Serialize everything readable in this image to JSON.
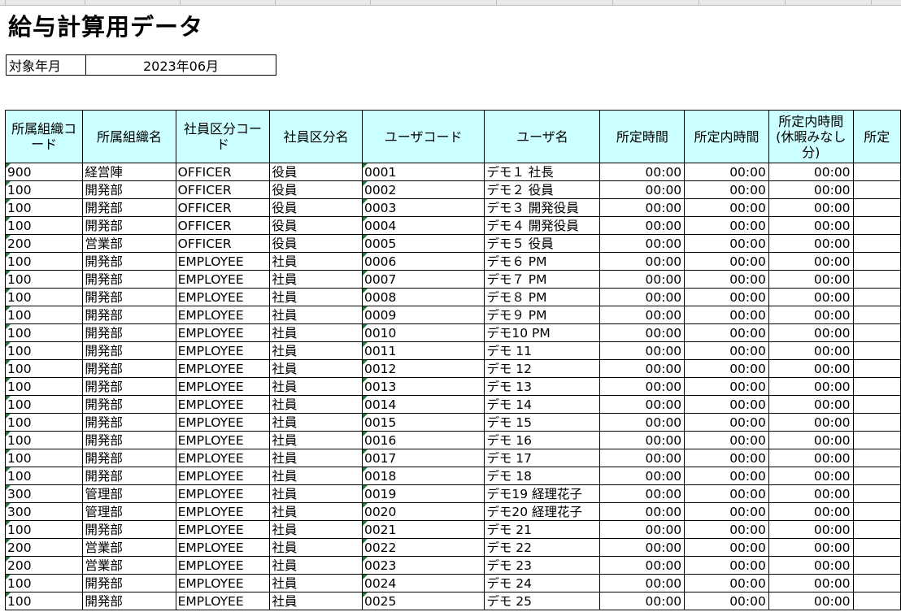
{
  "sheet": {
    "title": "給与計算用データ",
    "period_label": "対象年月",
    "period_value": "2023年06月"
  },
  "columns": [
    "所属組織コード",
    "所属組織名",
    "社員区分コード",
    "社員区分名",
    "ユーザコード",
    "ユーザ名",
    "所定時間",
    "所定内時間",
    "所定内時間(休暇みなし分)",
    "所定"
  ],
  "header_bg": "#ccffff",
  "rows": [
    [
      "900",
      "経営陣",
      "OFFICER",
      "役員",
      "0001",
      "デモ１ 社長",
      "00:00",
      "00:00",
      "00:00"
    ],
    [
      "100",
      "開発部",
      "OFFICER",
      "役員",
      "0002",
      "デモ２ 役員",
      "00:00",
      "00:00",
      "00:00"
    ],
    [
      "100",
      "開発部",
      "OFFICER",
      "役員",
      "0003",
      "デモ３ 開発役員",
      "00:00",
      "00:00",
      "00:00"
    ],
    [
      "100",
      "開発部",
      "OFFICER",
      "役員",
      "0004",
      "デモ４ 開発役員",
      "00:00",
      "00:00",
      "00:00"
    ],
    [
      "200",
      "営業部",
      "OFFICER",
      "役員",
      "0005",
      "デモ５ 役員",
      "00:00",
      "00:00",
      "00:00"
    ],
    [
      "100",
      "開発部",
      "EMPLOYEE",
      "社員",
      "0006",
      "デモ６ PM",
      "00:00",
      "00:00",
      "00:00"
    ],
    [
      "100",
      "開発部",
      "EMPLOYEE",
      "社員",
      "0007",
      "デモ７ PM",
      "00:00",
      "00:00",
      "00:00"
    ],
    [
      "100",
      "開発部",
      "EMPLOYEE",
      "社員",
      "0008",
      "デモ８ PM",
      "00:00",
      "00:00",
      "00:00"
    ],
    [
      "100",
      "開発部",
      "EMPLOYEE",
      "社員",
      "0009",
      "デモ９ PM",
      "00:00",
      "00:00",
      "00:00"
    ],
    [
      "100",
      "開発部",
      "EMPLOYEE",
      "社員",
      "0010",
      "デモ10 PM",
      "00:00",
      "00:00",
      "00:00"
    ],
    [
      "100",
      "開発部",
      "EMPLOYEE",
      "社員",
      "0011",
      "デモ 11",
      "00:00",
      "00:00",
      "00:00"
    ],
    [
      "100",
      "開発部",
      "EMPLOYEE",
      "社員",
      "0012",
      "デモ 12",
      "00:00",
      "00:00",
      "00:00"
    ],
    [
      "100",
      "開発部",
      "EMPLOYEE",
      "社員",
      "0013",
      "デモ 13",
      "00:00",
      "00:00",
      "00:00"
    ],
    [
      "100",
      "開発部",
      "EMPLOYEE",
      "社員",
      "0014",
      "デモ 14",
      "00:00",
      "00:00",
      "00:00"
    ],
    [
      "100",
      "開発部",
      "EMPLOYEE",
      "社員",
      "0015",
      "デモ 15",
      "00:00",
      "00:00",
      "00:00"
    ],
    [
      "100",
      "開発部",
      "EMPLOYEE",
      "社員",
      "0016",
      "デモ 16",
      "00:00",
      "00:00",
      "00:00"
    ],
    [
      "100",
      "開発部",
      "EMPLOYEE",
      "社員",
      "0017",
      "デモ 17",
      "00:00",
      "00:00",
      "00:00"
    ],
    [
      "100",
      "開発部",
      "EMPLOYEE",
      "社員",
      "0018",
      "デモ 18",
      "00:00",
      "00:00",
      "00:00"
    ],
    [
      "300",
      "管理部",
      "EMPLOYEE",
      "社員",
      "0019",
      "デモ19 経理花子",
      "00:00",
      "00:00",
      "00:00"
    ],
    [
      "300",
      "管理部",
      "EMPLOYEE",
      "社員",
      "0020",
      "デモ20 経理花子",
      "00:00",
      "00:00",
      "00:00"
    ],
    [
      "100",
      "開発部",
      "EMPLOYEE",
      "社員",
      "0021",
      "デモ 21",
      "00:00",
      "00:00",
      "00:00"
    ],
    [
      "200",
      "営業部",
      "EMPLOYEE",
      "社員",
      "0022",
      "デモ 22",
      "00:00",
      "00:00",
      "00:00"
    ],
    [
      "200",
      "営業部",
      "EMPLOYEE",
      "社員",
      "0023",
      "デモ 23",
      "00:00",
      "00:00",
      "00:00"
    ],
    [
      "100",
      "開発部",
      "EMPLOYEE",
      "社員",
      "0024",
      "デモ 24",
      "00:00",
      "00:00",
      "00:00"
    ],
    [
      "100",
      "開発部",
      "EMPLOYEE",
      "社員",
      "0025",
      "デモ 25",
      "00:00",
      "00:00",
      "00:00"
    ]
  ]
}
